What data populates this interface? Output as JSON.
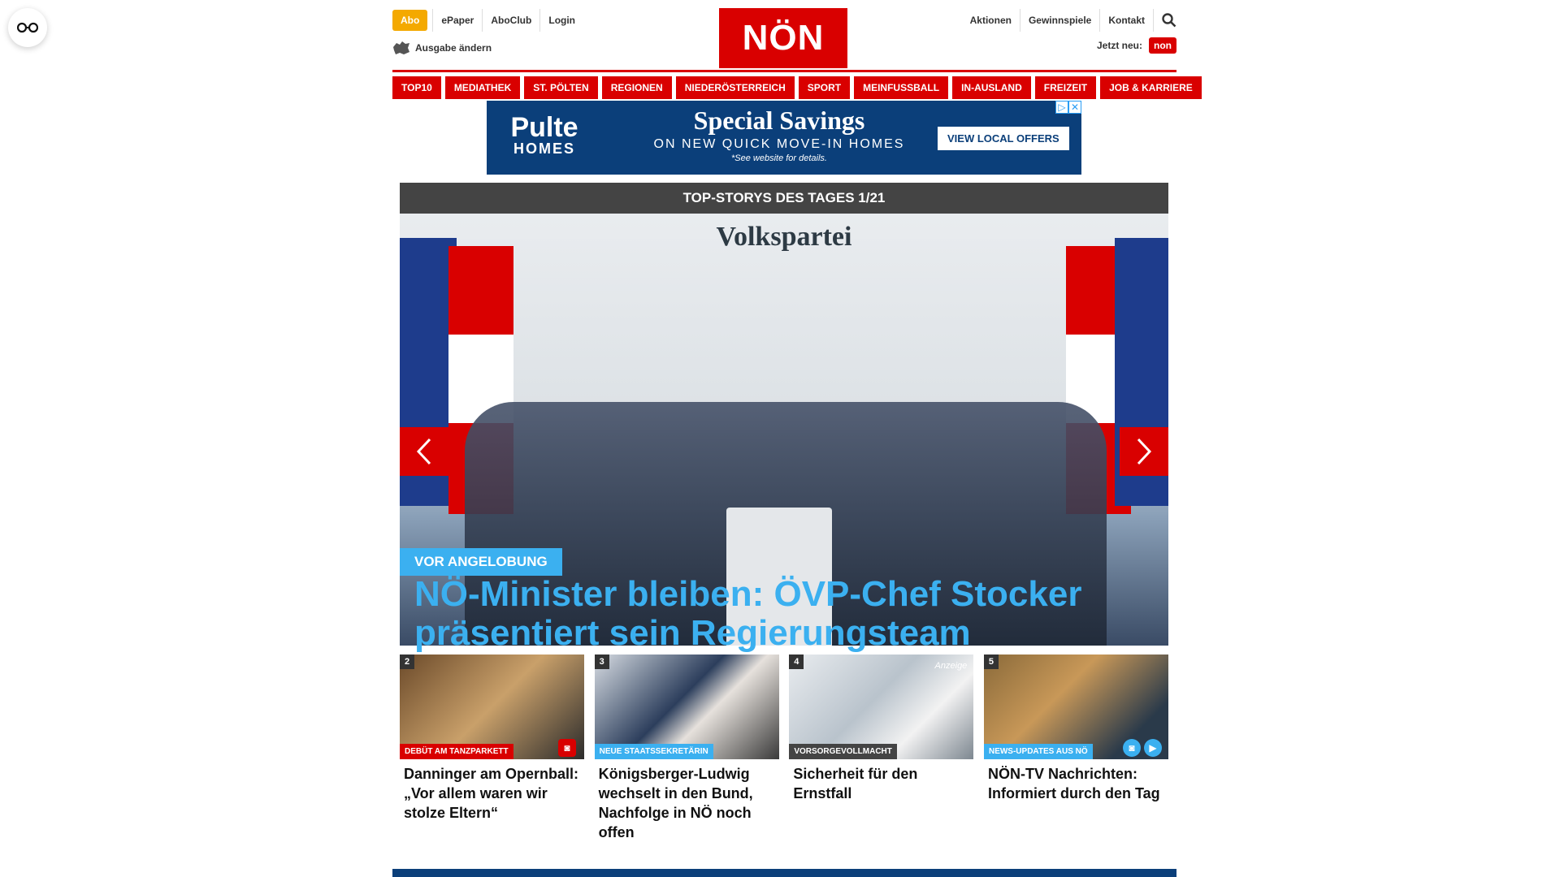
{
  "topnav": {
    "abo": "Abo",
    "links": [
      "ePaper",
      "AboClub",
      "Login"
    ]
  },
  "ausgabe": "Ausgabe ändern",
  "logo": "NÖN",
  "rightnav": {
    "links": [
      "Aktionen",
      "Gewinnspiele",
      "Kontakt"
    ]
  },
  "jetzt_neu": "Jetzt neu:",
  "jetzt_badge": "non",
  "categories": [
    "TOP10",
    "MEDIATHEK",
    "ST. PÖLTEN",
    "REGIONEN",
    "NIEDERÖSTERREICH",
    "SPORT",
    "MEINFUSSBALL",
    "IN-AUSLAND",
    "FREIZEIT",
    "JOB & KARRIERE"
  ],
  "ad": {
    "brand_top": "Pulte",
    "brand_bottom": "HOMES",
    "headline": "Special Savings",
    "subline": "ON NEW QUICK MOVE-IN HOMES",
    "note": "*See website for details.",
    "cta": "VIEW LOCAL OFFERS"
  },
  "slider": {
    "title": "TOP-STORYS DES TAGES 1/21",
    "backdrop": "Volkspartei",
    "kicker": "VOR ANGELOBUNG",
    "headline": "NÖ-Minister bleiben: ÖVP-Chef Stocker präsentiert sein Regierungsteam"
  },
  "teasers": [
    {
      "num": "2",
      "tag": "DEBÜT AM TANZPARKETT",
      "tag_color": "#d90000",
      "title": "Danninger am Opernball: „Vor allem waren wir stolze Eltern“"
    },
    {
      "num": "3",
      "tag": "NEUE STAATSSEKRETÄRIN",
      "tag_color": "#3bb0f0",
      "title": "Königsberger-Ludwig wechselt in den Bund, Nachfolge in NÖ noch offen"
    },
    {
      "num": "4",
      "tag": "VORSORGEVOLLMACHT",
      "tag_color": "#444444",
      "anzeige": "Anzeige",
      "title": "Sicherheit für den Ernstfall"
    },
    {
      "num": "5",
      "tag": "NEWS-UPDATES AUS NÖ",
      "tag_color": "#3bb0f0",
      "title": "NÖN-TV Nachrichten: Informiert durch den Tag"
    }
  ],
  "colors": {
    "brand_red": "#d90000",
    "accent_blue": "#3bb0f0",
    "abo_yellow": "#f4a900"
  }
}
